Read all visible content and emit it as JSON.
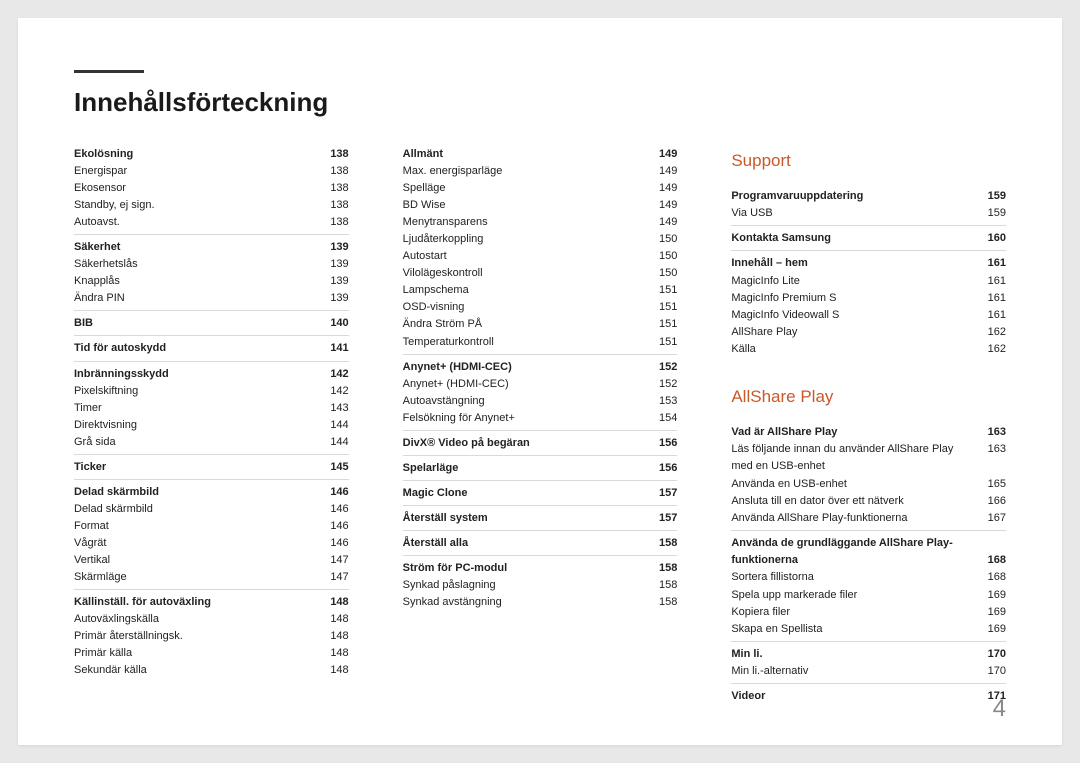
{
  "title": "Innehållsförteckning",
  "pageNumber": "4",
  "col1": [
    {
      "t": "bold",
      "label": "Ekolösning",
      "page": "138"
    },
    {
      "t": "row",
      "label": "Energispar",
      "page": "138"
    },
    {
      "t": "row",
      "label": "Ekosensor",
      "page": "138"
    },
    {
      "t": "row",
      "label": "Standby, ej sign.",
      "page": "138"
    },
    {
      "t": "row",
      "label": "Autoavst.",
      "page": "138"
    },
    {
      "t": "div"
    },
    {
      "t": "bold",
      "label": "Säkerhet",
      "page": "139"
    },
    {
      "t": "row",
      "label": "Säkerhetslås",
      "page": "139"
    },
    {
      "t": "row",
      "label": "Knapplås",
      "page": "139"
    },
    {
      "t": "row",
      "label": "Ändra PIN",
      "page": "139"
    },
    {
      "t": "div"
    },
    {
      "t": "bold",
      "label": "BIB",
      "page": "140"
    },
    {
      "t": "div"
    },
    {
      "t": "bold",
      "label": "Tid för autoskydd",
      "page": "141"
    },
    {
      "t": "div"
    },
    {
      "t": "bold",
      "label": "Inbränningsskydd",
      "page": "142"
    },
    {
      "t": "row",
      "label": "Pixelskiftning",
      "page": "142"
    },
    {
      "t": "row",
      "label": "Timer",
      "page": "143"
    },
    {
      "t": "row",
      "label": "Direktvisning",
      "page": "144"
    },
    {
      "t": "row",
      "label": "Grå sida",
      "page": "144"
    },
    {
      "t": "div"
    },
    {
      "t": "bold",
      "label": "Ticker",
      "page": "145"
    },
    {
      "t": "div"
    },
    {
      "t": "bold",
      "label": "Delad skärmbild",
      "page": "146"
    },
    {
      "t": "row",
      "label": "Delad skärmbild",
      "page": "146"
    },
    {
      "t": "row",
      "label": "Format",
      "page": "146"
    },
    {
      "t": "row",
      "label": "Vågrät",
      "page": "146"
    },
    {
      "t": "row",
      "label": "Vertikal",
      "page": "147"
    },
    {
      "t": "row",
      "label": "Skärmläge",
      "page": "147"
    },
    {
      "t": "div"
    },
    {
      "t": "bold",
      "label": "Källinställ. för autoväxling",
      "page": "148"
    },
    {
      "t": "row",
      "label": "Autoväxlingskälla",
      "page": "148"
    },
    {
      "t": "row",
      "label": "Primär återställningsk.",
      "page": "148"
    },
    {
      "t": "row",
      "label": "Primär källa",
      "page": "148"
    },
    {
      "t": "row",
      "label": "Sekundär källa",
      "page": "148"
    }
  ],
  "col2": [
    {
      "t": "bold",
      "label": "Allmänt",
      "page": "149"
    },
    {
      "t": "row",
      "label": "Max. energisparläge",
      "page": "149"
    },
    {
      "t": "row",
      "label": "Spelläge",
      "page": "149"
    },
    {
      "t": "row",
      "label": "BD Wise",
      "page": "149"
    },
    {
      "t": "row",
      "label": "Menytransparens",
      "page": "149"
    },
    {
      "t": "row",
      "label": "Ljudåterkoppling",
      "page": "150"
    },
    {
      "t": "row",
      "label": "Autostart",
      "page": "150"
    },
    {
      "t": "row",
      "label": "Vilolägeskontroll",
      "page": "150"
    },
    {
      "t": "row",
      "label": "Lampschema",
      "page": "151"
    },
    {
      "t": "row",
      "label": "OSD-visning",
      "page": "151"
    },
    {
      "t": "row",
      "label": "Ändra Ström PÅ",
      "page": "151"
    },
    {
      "t": "row",
      "label": "Temperaturkontroll",
      "page": "151"
    },
    {
      "t": "div"
    },
    {
      "t": "bold",
      "label": "Anynet+ (HDMI-CEC)",
      "page": "152"
    },
    {
      "t": "row",
      "label": "Anynet+ (HDMI-CEC)",
      "page": "152"
    },
    {
      "t": "row",
      "label": "Autoavstängning",
      "page": "153"
    },
    {
      "t": "row",
      "label": "Felsökning för Anynet+",
      "page": "154"
    },
    {
      "t": "div"
    },
    {
      "t": "bold",
      "label": "DivX® Video på begäran",
      "page": "156"
    },
    {
      "t": "div"
    },
    {
      "t": "bold",
      "label": "Spelarläge",
      "page": "156"
    },
    {
      "t": "div"
    },
    {
      "t": "bold",
      "label": "Magic Clone",
      "page": "157"
    },
    {
      "t": "div"
    },
    {
      "t": "bold",
      "label": "Återställ system",
      "page": "157"
    },
    {
      "t": "div"
    },
    {
      "t": "bold",
      "label": "Återställ alla",
      "page": "158"
    },
    {
      "t": "div"
    },
    {
      "t": "bold",
      "label": "Ström för PC-modul",
      "page": "158"
    },
    {
      "t": "row",
      "label": "Synkad påslagning",
      "page": "158"
    },
    {
      "t": "row",
      "label": "Synkad avstängning",
      "page": "158"
    }
  ],
  "col3": [
    {
      "t": "heading",
      "label": "Support"
    },
    {
      "t": "bold",
      "label": "Programvaruuppdatering",
      "page": "159"
    },
    {
      "t": "row",
      "label": "Via USB",
      "page": "159"
    },
    {
      "t": "div"
    },
    {
      "t": "bold",
      "label": "Kontakta Samsung",
      "page": "160"
    },
    {
      "t": "div"
    },
    {
      "t": "bold",
      "label": "Innehåll – hem",
      "page": "161"
    },
    {
      "t": "row",
      "label": "MagicInfo Lite",
      "page": "161"
    },
    {
      "t": "row",
      "label": "MagicInfo Premium S",
      "page": "161"
    },
    {
      "t": "row",
      "label": "MagicInfo Videowall S",
      "page": "161"
    },
    {
      "t": "row",
      "label": "AllShare Play",
      "page": "162"
    },
    {
      "t": "row",
      "label": "Källa",
      "page": "162"
    },
    {
      "t": "heading-gap",
      "label": "AllShare Play"
    },
    {
      "t": "bold",
      "label": "Vad är AllShare Play",
      "page": "163"
    },
    {
      "t": "wrap",
      "label": "Läs följande innan du använder AllShare Play med en USB-enhet",
      "page": "163"
    },
    {
      "t": "row",
      "label": "Använda en USB-enhet",
      "page": "165"
    },
    {
      "t": "row",
      "label": "Ansluta till en dator över ett nätverk",
      "page": "166"
    },
    {
      "t": "row",
      "label": "Använda AllShare Play-funktionerna",
      "page": "167"
    },
    {
      "t": "div"
    },
    {
      "t": "bold2",
      "label1": "Använda de grundläggande AllShare Play-",
      "label2": "funktionerna",
      "page": "168"
    },
    {
      "t": "row",
      "label": "Sortera fillistorna",
      "page": "168"
    },
    {
      "t": "row",
      "label": "Spela upp markerade filer",
      "page": "169"
    },
    {
      "t": "row",
      "label": "Kopiera filer",
      "page": "169"
    },
    {
      "t": "row",
      "label": "Skapa en Spellista",
      "page": "169"
    },
    {
      "t": "div"
    },
    {
      "t": "bold",
      "label": "Min li.",
      "page": "170"
    },
    {
      "t": "row",
      "label": "Min li.-alternativ",
      "page": "170"
    },
    {
      "t": "div"
    },
    {
      "t": "bold",
      "label": "Videor",
      "page": "171"
    }
  ]
}
